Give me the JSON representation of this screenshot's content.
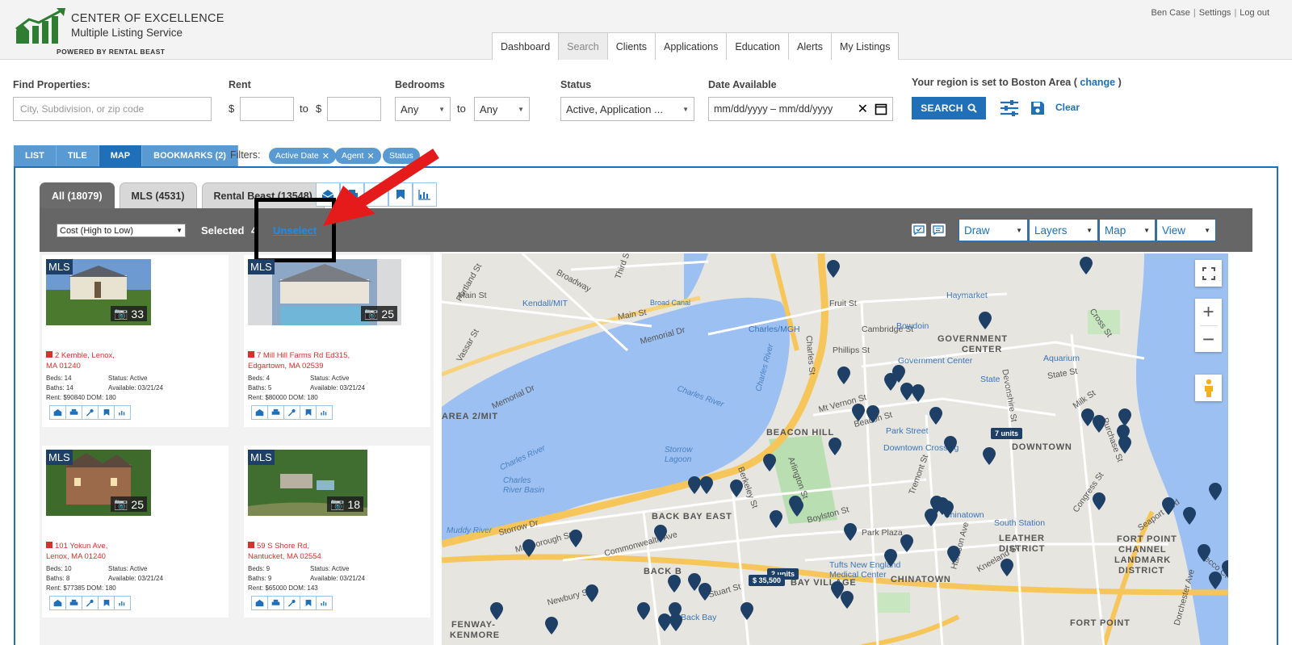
{
  "brand": {
    "title": "CENTER OF EXCELLENCE",
    "subtitle": "Multiple Listing Service",
    "powered": "POWERED BY RENTAL BEAST",
    "green": "#2f7d32"
  },
  "user_links": {
    "name": "Ben Case",
    "settings": "Settings",
    "logout": "Log out"
  },
  "nav": [
    "Dashboard",
    "Search",
    "Clients",
    "Applications",
    "Education",
    "Alerts",
    "My Listings"
  ],
  "search": {
    "find_label": "Find Properties:",
    "find_placeholder": "City, Subdivision, or zip code",
    "rent_label": "Rent",
    "dollar": "$",
    "to": "to",
    "bedrooms_label": "Bedrooms",
    "bed_min": "Any",
    "bed_max": "Any",
    "status_label": "Status",
    "status_value": "Active, Application ...",
    "date_label": "Date Available",
    "date_value": "mm/dd/yyyy – mm/dd/yyyy",
    "region_text": "Your region is set to Boston Area (",
    "region_link": "change",
    "region_close": ")",
    "search_button": "SEARCH",
    "clear": "Clear"
  },
  "views": [
    "LIST",
    "TILE",
    "MAP",
    "BOOKMARKS (2)"
  ],
  "filters": {
    "label": "Filters:",
    "chips": [
      "Active Date",
      "Agent",
      "Status"
    ]
  },
  "subtabs": [
    "All (18079)",
    "MLS (4531)",
    "Rental Beast (13548)"
  ],
  "toolbar": {
    "sort": "Cost (High to Low)",
    "selected_label": "Selected",
    "selected_count": "4",
    "unselect": "Unselect",
    "draw": "Draw",
    "layers": "Layers",
    "map": "Map",
    "view": "View"
  },
  "listings": [
    {
      "tag": "MLS",
      "photos": "33",
      "addr1": "2 Kemble, Lenox,",
      "addr2": "MA 01240",
      "beds": "Beds: 14",
      "status": "Status: Active",
      "baths": "Baths: 14",
      "available": "Available: 03/21/24",
      "rent": "Rent: $90840",
      "dom": "DOM: 180"
    },
    {
      "tag": "MLS",
      "photos": "25",
      "addr1": "7 Mill Hill Farms Rd Ed315,",
      "addr2": "Edgartown, MA 02539",
      "beds": "Beds: 4",
      "status": "Status: Active",
      "baths": "Baths: 5",
      "available": "Available: 03/21/24",
      "rent": "Rent: $80000",
      "dom": "DOM: 180"
    },
    {
      "tag": "MLS",
      "photos": "25",
      "addr1": "101 Yokun Ave,",
      "addr2": "Lenox, MA 01240",
      "beds": "Beds: 10",
      "status": "Status: Active",
      "baths": "Baths: 8",
      "available": "Available: 03/21/24",
      "rent": "Rent: $77385",
      "dom": "DOM: 180"
    },
    {
      "tag": "MLS",
      "photos": "18",
      "addr1": "59 S Shore Rd,",
      "addr2": "Nantucket, MA 02554",
      "beds": "Beds: 9",
      "status": "Status: Active",
      "baths": "Baths: 9",
      "available": "Available: 03/21/24",
      "rent": "Rent: $65000",
      "dom": "DOM: 143"
    }
  ],
  "map": {
    "districts": [
      "GOVERNMENT",
      "CENTER",
      "BEACON HILL",
      "DOWNTOWN",
      "BACK BAY EAST",
      "BACK B",
      "BAY VILLAGE",
      "CHINATOWN",
      "LEATHER",
      "DISTRICT",
      "FORT POINT",
      "CHANNEL",
      "LANDMARK",
      "DISTRICT",
      "FORT POINT",
      "FENWAY-",
      "KENMORE",
      "AREA 2/MIT"
    ],
    "streets": [
      "Main St",
      "Broadway",
      "Third St",
      "Main St",
      "Memorial Dr",
      "Memorial Dr",
      "Cambridge St",
      "Charles St",
      "Beacon St",
      "Boylston St",
      "Arlington St",
      "Commonwealth Ave",
      "Stuart St",
      "Tremont St",
      "Congress St",
      "Seaport Blvd",
      "Milk St",
      "State St",
      "Devonshire St",
      "Marlborough St",
      "Newbury St",
      "Storrow Dr",
      "Berkeley St",
      "Park Plaza",
      "Kneeland St",
      "Harrison Ave",
      "Portland St",
      "Vassar St",
      "Fruit St",
      "Phillips St",
      "Mt Vernon St",
      "Cross St",
      "Purchase St",
      "Dorchester Ave",
      "Necco Ct"
    ],
    "places": [
      "Kendall/MIT",
      "Charles/MGH",
      "Bowdoin",
      "Haymarket",
      "Government Center",
      "Aquarium",
      "State",
      "Park Street",
      "Downtown Crossing",
      "Chinatown",
      "South Station",
      "Tufts New England Medical Center",
      "Back Bay",
      "Broad Canal"
    ],
    "water": [
      "Charles River",
      "Charles River",
      "Charles River",
      "Charles River Basin",
      "Storrow Lagoon",
      "Muddy River"
    ],
    "units_7": "7 units",
    "units_2": "2 units",
    "price_tag": "$ 35,500"
  }
}
